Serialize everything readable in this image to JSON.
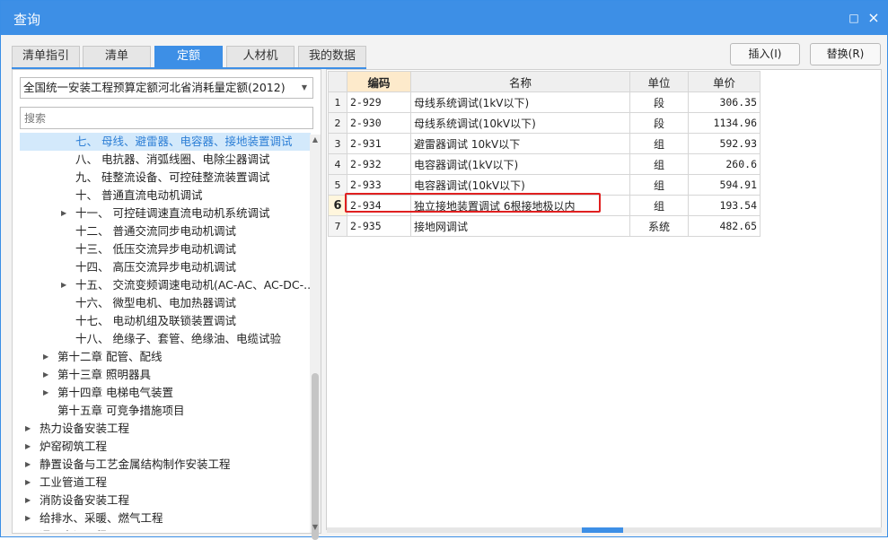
{
  "window": {
    "title": "查询",
    "restore_glyph": "□",
    "close_glyph": "×"
  },
  "tabs": [
    {
      "label": "清单指引"
    },
    {
      "label": "清单"
    },
    {
      "label": "定额",
      "active": true
    },
    {
      "label": "人材机"
    },
    {
      "label": "我的数据"
    }
  ],
  "actions": {
    "insert_label": "插入(I)",
    "replace_label": "替换(R)"
  },
  "left": {
    "quota_library": "全国统一安装工程预算定额河北省消耗量定额(2012)",
    "search_placeholder": "搜索",
    "tree": [
      {
        "label": "七、 母线、避雷器、电容器、接地装置调试",
        "indent": 3,
        "expander": false,
        "selected": true
      },
      {
        "label": "八、 电抗器、消弧线圈、电除尘器调试",
        "indent": 3,
        "expander": false
      },
      {
        "label": "九、 硅整流设备、可控硅整流装置调试",
        "indent": 3,
        "expander": false
      },
      {
        "label": "十、 普通直流电动机调试",
        "indent": 3,
        "expander": false
      },
      {
        "label": "十一、 可控硅调速直流电动机系统调试",
        "indent": 3,
        "expander": true
      },
      {
        "label": "十二、 普通交流同步电动机调试",
        "indent": 3,
        "expander": false
      },
      {
        "label": "十三、 低压交流异步电动机调试",
        "indent": 3,
        "expander": false
      },
      {
        "label": "十四、 高压交流异步电动机调试",
        "indent": 3,
        "expander": false
      },
      {
        "label": "十五、 交流变频调速电动机(AC-AC、AC-DC-...",
        "indent": 3,
        "expander": true
      },
      {
        "label": "十六、 微型电机、电加热器调试",
        "indent": 3,
        "expander": false
      },
      {
        "label": "十七、 电动机组及联锁装置调试",
        "indent": 3,
        "expander": false
      },
      {
        "label": "十八、 绝缘子、套管、绝缘油、电缆试验",
        "indent": 3,
        "expander": false
      },
      {
        "label": "第十二章 配管、配线",
        "indent": 2,
        "expander": true
      },
      {
        "label": "第十三章 照明器具",
        "indent": 2,
        "expander": true
      },
      {
        "label": "第十四章 电梯电气装置",
        "indent": 2,
        "expander": true
      },
      {
        "label": "第十五章 可竞争措施项目",
        "indent": 2,
        "expander": false
      },
      {
        "label": "热力设备安装工程",
        "indent": 1,
        "expander": true
      },
      {
        "label": "炉窑砌筑工程",
        "indent": 1,
        "expander": true
      },
      {
        "label": "静置设备与工艺金属结构制作安装工程",
        "indent": 1,
        "expander": true
      },
      {
        "label": "工业管道工程",
        "indent": 1,
        "expander": true
      },
      {
        "label": "消防设备安装工程",
        "indent": 1,
        "expander": true
      },
      {
        "label": "给排水、采暖、燃气工程",
        "indent": 1,
        "expander": true
      },
      {
        "label": "通风空调工程",
        "indent": 1,
        "expander": true
      }
    ]
  },
  "grid": {
    "columns": [
      "编码",
      "名称",
      "单位",
      "单价"
    ],
    "rows": [
      {
        "no": "1",
        "code": "2-929",
        "name": "母线系统调试(1kV以下)",
        "unit": "段",
        "price": "306.35"
      },
      {
        "no": "2",
        "code": "2-930",
        "name": "母线系统调试(10kV以下)",
        "unit": "段",
        "price": "1134.96"
      },
      {
        "no": "3",
        "code": "2-931",
        "name": "避雷器调试 10kV以下",
        "unit": "组",
        "price": "592.93"
      },
      {
        "no": "4",
        "code": "2-932",
        "name": "电容器调试(1kV以下)",
        "unit": "组",
        "price": "260.6"
      },
      {
        "no": "5",
        "code": "2-933",
        "name": "电容器调试(10kV以下)",
        "unit": "组",
        "price": "594.91"
      },
      {
        "no": "6",
        "code": "2-934",
        "name": "独立接地装置调试 6根接地极以内",
        "unit": "组",
        "price": "193.54",
        "current": true
      },
      {
        "no": "7",
        "code": "2-935",
        "name": "接地网调试",
        "unit": "系统",
        "price": "482.65"
      }
    ]
  },
  "colors": {
    "accent": "#3d8fe6",
    "highlight": "#e02020",
    "selected_row": "#d3e9fb"
  }
}
